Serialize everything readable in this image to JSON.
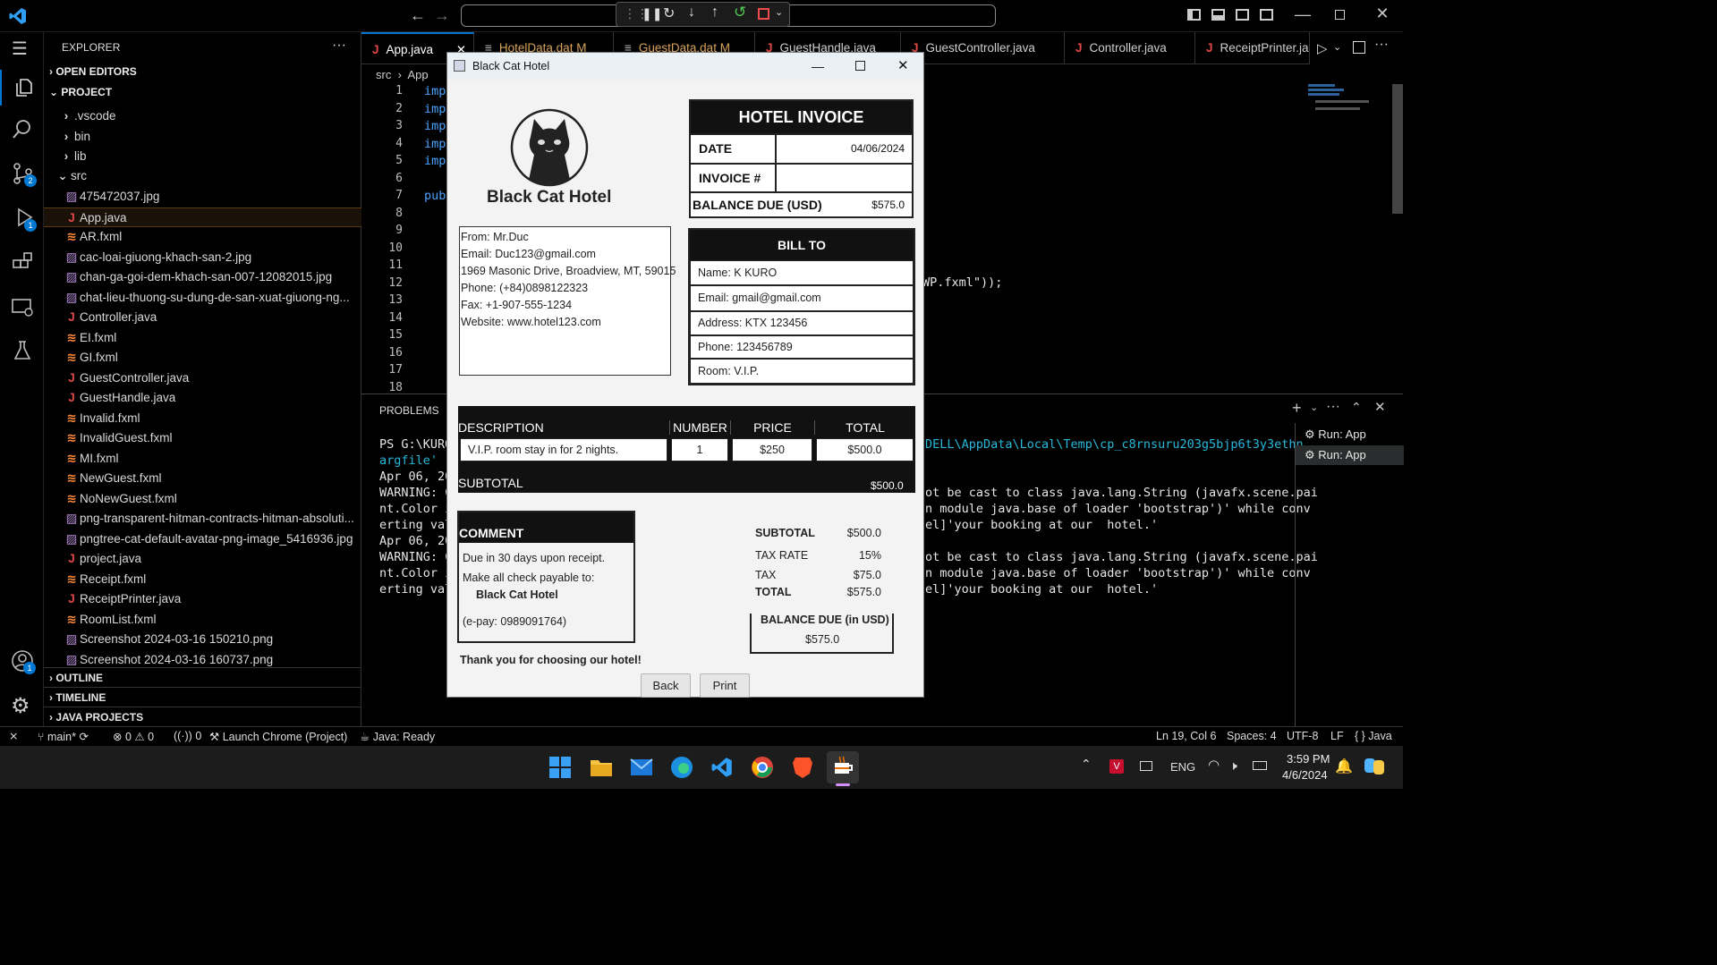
{
  "titlebar": {
    "search_value": ""
  },
  "debug_toolbar": {
    "icons": [
      "grip-icon",
      "pause-icon",
      "step-over-icon",
      "step-into-icon",
      "step-out-icon",
      "restart-icon",
      "stop-icon",
      "chevron-down-icon"
    ]
  },
  "explorer": {
    "header": "EXPLORER",
    "open_editors": "OPEN EDITORS",
    "project": "PROJECT",
    "outline": "OUTLINE",
    "timeline": "TIMELINE",
    "java_projects": "JAVA PROJECTS",
    "items": [
      {
        "label": ".vscode",
        "kind": "folder"
      },
      {
        "label": "bin",
        "kind": "folder"
      },
      {
        "label": "lib",
        "kind": "folder"
      },
      {
        "label": "src",
        "kind": "folder-open"
      },
      {
        "label": "475472037.jpg",
        "kind": "img"
      },
      {
        "label": "App.java",
        "kind": "java"
      },
      {
        "label": "AR.fxml",
        "kind": "xml"
      },
      {
        "label": "cac-loai-giuong-khach-san-2.jpg",
        "kind": "img"
      },
      {
        "label": "chan-ga-goi-dem-khach-san-007-12082015.jpg",
        "kind": "img"
      },
      {
        "label": "chat-lieu-thuong-su-dung-de-san-xuat-giuong-ng...",
        "kind": "img"
      },
      {
        "label": "Controller.java",
        "kind": "java"
      },
      {
        "label": "EI.fxml",
        "kind": "xml"
      },
      {
        "label": "GI.fxml",
        "kind": "xml"
      },
      {
        "label": "GuestController.java",
        "kind": "java"
      },
      {
        "label": "GuestHandle.java",
        "kind": "java"
      },
      {
        "label": "Invalid.fxml",
        "kind": "xml"
      },
      {
        "label": "InvalidGuest.fxml",
        "kind": "xml"
      },
      {
        "label": "MI.fxml",
        "kind": "xml"
      },
      {
        "label": "NewGuest.fxml",
        "kind": "xml"
      },
      {
        "label": "NoNewGuest.fxml",
        "kind": "xml"
      },
      {
        "label": "png-transparent-hitman-contracts-hitman-absoluti...",
        "kind": "img"
      },
      {
        "label": "pngtree-cat-default-avatar-png-image_5416936.jpg",
        "kind": "img"
      },
      {
        "label": "project.java",
        "kind": "java"
      },
      {
        "label": "Receipt.fxml",
        "kind": "xml"
      },
      {
        "label": "ReceiptPrinter.java",
        "kind": "java"
      },
      {
        "label": "RoomList.fxml",
        "kind": "xml"
      },
      {
        "label": "Screenshot 2024-03-16 150210.png",
        "kind": "img"
      },
      {
        "label": "Screenshot 2024-03-16 160737.png",
        "kind": "img"
      }
    ]
  },
  "tabs": [
    {
      "label": "App.java",
      "kind": "java"
    },
    {
      "label": "HotelData.dat M",
      "kind": "dat"
    },
    {
      "label": "GuestData.dat M",
      "kind": "dat"
    },
    {
      "label": "GuestHandle.java",
      "kind": "java"
    },
    {
      "label": "GuestController.java",
      "kind": "java"
    },
    {
      "label": "Controller.java",
      "kind": "java"
    },
    {
      "label": "ReceiptPrinter.ja",
      "kind": "java"
    }
  ],
  "editor": {
    "breadcrumb_src": "src",
    "breadcrumb_file": "App",
    "line_numbers": [
      "1",
      "2",
      "3",
      "4",
      "5",
      "6",
      "7",
      "8",
      "9",
      "10",
      "11",
      "12",
      "13",
      "14",
      "15",
      "16",
      "17",
      "18"
    ],
    "code_lines": [
      "impo",
      "impo",
      "impo",
      "impo",
      "impo",
      "",
      "pub"
    ],
    "code_fragment": "WP.fxml\"));"
  },
  "panel": {
    "tab": "PROBLEMS",
    "run_items": [
      "Run: App",
      "Run: App"
    ],
    "left_lines": [
      "PS G:\\KURO",
      "argfile' '",
      "Apr 06, 20",
      "WARNING: C",
      "nt.Color i",
      "erting val",
      "Apr 06, 20",
      "WARNING: C",
      "nt.Color i",
      "erting val"
    ],
    "right_lines": [
      "DELL\\AppData\\Local\\Temp\\cp_c8rnsuru203g5bjp6t3y3ethn.",
      "",
      "",
      "ot be cast to class java.lang.String (javafx.scene.pai",
      "n module java.base of loader 'bootstrap')' while conv",
      "el]'your booking at our  hotel.'",
      "",
      "ot be cast to class java.lang.String (javafx.scene.pai",
      "n module java.base of loader 'bootstrap')' while conv",
      "el]'your booking at our  hotel.'"
    ]
  },
  "status": {
    "branch": "main*",
    "errors": "0",
    "warnings": "0",
    "ports": "0",
    "launch": "Launch Chrome (Project)",
    "java": "Java: Ready",
    "position": "Ln 19, Col 6",
    "spaces": "Spaces: 4",
    "encoding": "UTF-8",
    "eol": "LF",
    "language": "Java"
  },
  "dialog": {
    "title": "Black Cat Hotel",
    "hotel_name": "Black Cat Hotel",
    "invoice_title": "HOTEL INVOICE",
    "date_label": "DATE",
    "date_value": "04/06/2024",
    "invoice_no_label": "INVOICE #",
    "invoice_no_value": "",
    "balance_label": "BALANCE DUE (USD)",
    "balance_value": "$575.0",
    "from_lines": [
      "From: Mr.Duc",
      "Email: Duc123@gmail.com",
      "1969 Masonic Drive, Broadview, MT, 59015",
      "Phone: (+84)0898122323",
      "Fax: +1-907-555-1234",
      "Website: www.hotel123.com"
    ],
    "bill_to_title": "BILL TO",
    "bill_to": [
      "Name: K KURO",
      "Email: gmail@gmail.com",
      "Address: KTX 123456",
      "Phone: 123456789",
      "Room: V.I.P."
    ],
    "table_headers": [
      "DESCRIPTION",
      "NUMBER",
      "PRICE",
      "TOTAL"
    ],
    "table_row": [
      "V.I.P. room stay in for 2 nights.",
      "1",
      "$250",
      "$500.0"
    ],
    "subtotal_label": "SUBTOTAL",
    "subtotal_value": "$500.0",
    "comment_title": "COMMENT",
    "comment_lines": [
      "Due in 30 days upon receipt.",
      "Make all check payable to:"
    ],
    "comment_payee": "Black Cat Hotel",
    "comment_epay": "(e-pay: 0989091764)",
    "summary": [
      {
        "label": "SUBTOTAL",
        "value": "$500.0"
      },
      {
        "label": "TAX RATE",
        "value": "15%"
      },
      {
        "label": "TAX",
        "value": "$75.0"
      },
      {
        "label": "TOTAL",
        "value": "$575.0"
      }
    ],
    "balance_usd_label": "BALANCE DUE (in USD)",
    "balance_usd_value": "$575.0",
    "thanks": "Thank you for choosing our hotel!",
    "back_label": "Back",
    "print_label": "Print"
  },
  "taskbar": {
    "lang": "ENG",
    "time": "3:59 PM",
    "date": "4/6/2024"
  },
  "colors": {
    "accent": "#0078d4",
    "java_icon": "#e04848",
    "xml_icon": "#ff8a3d",
    "code_blue": "#4aa3ff",
    "terminal_link": "#29b8db"
  }
}
